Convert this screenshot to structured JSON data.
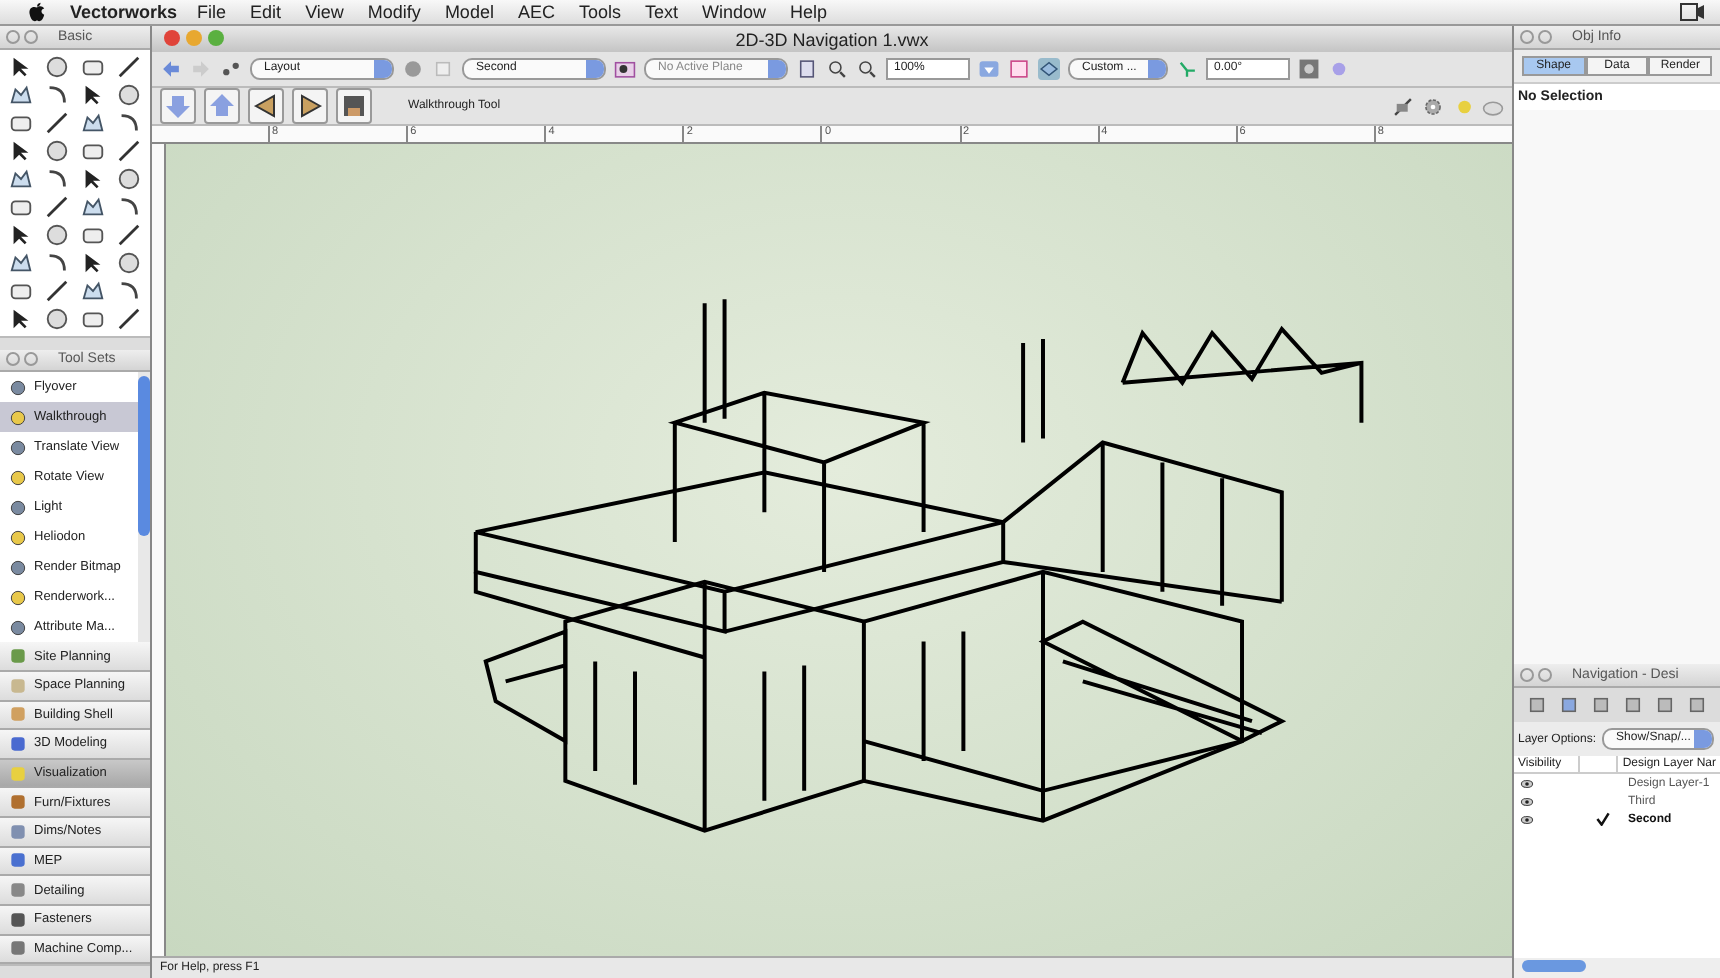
{
  "menu_bar": {
    "app": "Vectorworks",
    "items": [
      "File",
      "Edit",
      "View",
      "Modify",
      "Model",
      "AEC",
      "Tools",
      "Text",
      "Window",
      "Help"
    ]
  },
  "basic_palette": {
    "title": "Basic"
  },
  "tool_sets_palette": {
    "title": "Tool Sets",
    "tools": [
      {
        "label": "Flyover",
        "selected": false
      },
      {
        "label": "Walkthrough",
        "selected": true
      },
      {
        "label": "Translate View",
        "selected": false
      },
      {
        "label": "Rotate View",
        "selected": false
      },
      {
        "label": "Light",
        "selected": false
      },
      {
        "label": "Heliodon",
        "selected": false
      },
      {
        "label": "Render Bitmap",
        "selected": false
      },
      {
        "label": "Renderwork...",
        "selected": false
      },
      {
        "label": "Attribute Ma...",
        "selected": false
      }
    ],
    "sets": [
      {
        "label": "Site Planning",
        "selected": false
      },
      {
        "label": "Space Planning",
        "selected": false
      },
      {
        "label": "Building Shell",
        "selected": false
      },
      {
        "label": "3D Modeling",
        "selected": false
      },
      {
        "label": "Visualization",
        "selected": true
      },
      {
        "label": "Furn/Fixtures",
        "selected": false
      },
      {
        "label": "Dims/Notes",
        "selected": false
      },
      {
        "label": "MEP",
        "selected": false
      },
      {
        "label": "Detailing",
        "selected": false
      },
      {
        "label": "Fasteners",
        "selected": false
      },
      {
        "label": "Machine Comp...",
        "selected": false
      }
    ]
  },
  "document": {
    "title": "2D-3D Navigation 1.vwx",
    "view_bar": {
      "class_menu": "Layout",
      "layer_menu": "Second",
      "plane_menu": "No Active Plane",
      "zoom": "100%",
      "view_menu": "Custom ...",
      "angle": "0.00°"
    },
    "mode_bar": {
      "tool_name": "Walkthrough Tool"
    },
    "ruler": [
      "8",
      "6",
      "4",
      "2",
      "0",
      "2",
      "4",
      "6",
      "8"
    ],
    "status_bar": "For Help, press F1"
  },
  "obj_info": {
    "title": "Obj Info",
    "tabs": [
      {
        "label": "Shape",
        "selected": true
      },
      {
        "label": "Data",
        "selected": false
      },
      {
        "label": "Render",
        "selected": false
      }
    ],
    "message": "No Selection"
  },
  "navigation": {
    "title": "Navigation - Desi",
    "layer_options_label": "Layer Options:",
    "layer_options": "Show/Snap/...",
    "columns": [
      "Visibility",
      "Design Layer Nar"
    ],
    "layers": [
      {
        "name": "Design Layer-1",
        "active": false
      },
      {
        "name": "Third",
        "active": false
      },
      {
        "name": "Second",
        "active": true
      }
    ]
  }
}
